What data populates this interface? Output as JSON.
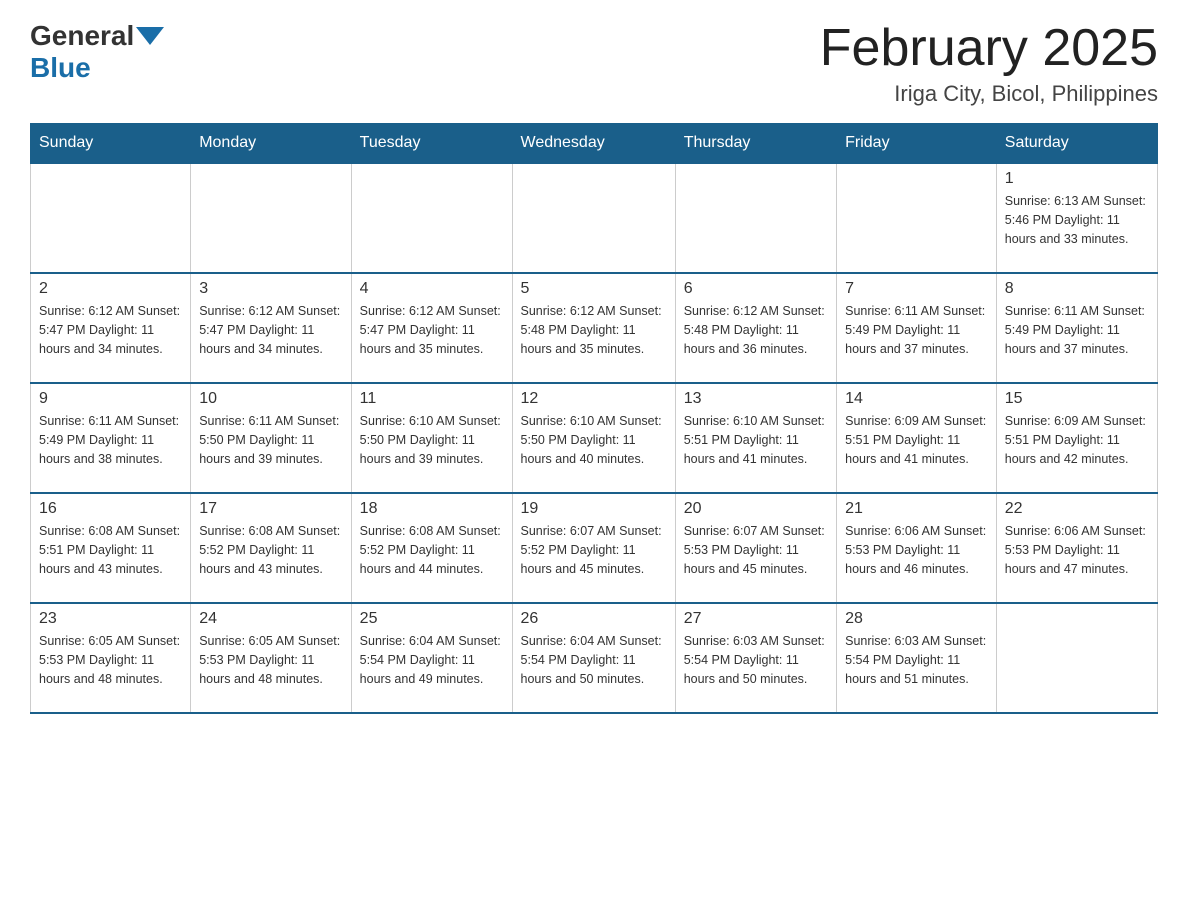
{
  "header": {
    "logo_general": "General",
    "logo_blue": "Blue",
    "month_title": "February 2025",
    "location": "Iriga City, Bicol, Philippines"
  },
  "days_of_week": [
    "Sunday",
    "Monday",
    "Tuesday",
    "Wednesday",
    "Thursday",
    "Friday",
    "Saturday"
  ],
  "weeks": [
    {
      "days": [
        {
          "number": "",
          "info": ""
        },
        {
          "number": "",
          "info": ""
        },
        {
          "number": "",
          "info": ""
        },
        {
          "number": "",
          "info": ""
        },
        {
          "number": "",
          "info": ""
        },
        {
          "number": "",
          "info": ""
        },
        {
          "number": "1",
          "info": "Sunrise: 6:13 AM\nSunset: 5:46 PM\nDaylight: 11 hours and 33 minutes."
        }
      ]
    },
    {
      "days": [
        {
          "number": "2",
          "info": "Sunrise: 6:12 AM\nSunset: 5:47 PM\nDaylight: 11 hours and 34 minutes."
        },
        {
          "number": "3",
          "info": "Sunrise: 6:12 AM\nSunset: 5:47 PM\nDaylight: 11 hours and 34 minutes."
        },
        {
          "number": "4",
          "info": "Sunrise: 6:12 AM\nSunset: 5:47 PM\nDaylight: 11 hours and 35 minutes."
        },
        {
          "number": "5",
          "info": "Sunrise: 6:12 AM\nSunset: 5:48 PM\nDaylight: 11 hours and 35 minutes."
        },
        {
          "number": "6",
          "info": "Sunrise: 6:12 AM\nSunset: 5:48 PM\nDaylight: 11 hours and 36 minutes."
        },
        {
          "number": "7",
          "info": "Sunrise: 6:11 AM\nSunset: 5:49 PM\nDaylight: 11 hours and 37 minutes."
        },
        {
          "number": "8",
          "info": "Sunrise: 6:11 AM\nSunset: 5:49 PM\nDaylight: 11 hours and 37 minutes."
        }
      ]
    },
    {
      "days": [
        {
          "number": "9",
          "info": "Sunrise: 6:11 AM\nSunset: 5:49 PM\nDaylight: 11 hours and 38 minutes."
        },
        {
          "number": "10",
          "info": "Sunrise: 6:11 AM\nSunset: 5:50 PM\nDaylight: 11 hours and 39 minutes."
        },
        {
          "number": "11",
          "info": "Sunrise: 6:10 AM\nSunset: 5:50 PM\nDaylight: 11 hours and 39 minutes."
        },
        {
          "number": "12",
          "info": "Sunrise: 6:10 AM\nSunset: 5:50 PM\nDaylight: 11 hours and 40 minutes."
        },
        {
          "number": "13",
          "info": "Sunrise: 6:10 AM\nSunset: 5:51 PM\nDaylight: 11 hours and 41 minutes."
        },
        {
          "number": "14",
          "info": "Sunrise: 6:09 AM\nSunset: 5:51 PM\nDaylight: 11 hours and 41 minutes."
        },
        {
          "number": "15",
          "info": "Sunrise: 6:09 AM\nSunset: 5:51 PM\nDaylight: 11 hours and 42 minutes."
        }
      ]
    },
    {
      "days": [
        {
          "number": "16",
          "info": "Sunrise: 6:08 AM\nSunset: 5:51 PM\nDaylight: 11 hours and 43 minutes."
        },
        {
          "number": "17",
          "info": "Sunrise: 6:08 AM\nSunset: 5:52 PM\nDaylight: 11 hours and 43 minutes."
        },
        {
          "number": "18",
          "info": "Sunrise: 6:08 AM\nSunset: 5:52 PM\nDaylight: 11 hours and 44 minutes."
        },
        {
          "number": "19",
          "info": "Sunrise: 6:07 AM\nSunset: 5:52 PM\nDaylight: 11 hours and 45 minutes."
        },
        {
          "number": "20",
          "info": "Sunrise: 6:07 AM\nSunset: 5:53 PM\nDaylight: 11 hours and 45 minutes."
        },
        {
          "number": "21",
          "info": "Sunrise: 6:06 AM\nSunset: 5:53 PM\nDaylight: 11 hours and 46 minutes."
        },
        {
          "number": "22",
          "info": "Sunrise: 6:06 AM\nSunset: 5:53 PM\nDaylight: 11 hours and 47 minutes."
        }
      ]
    },
    {
      "days": [
        {
          "number": "23",
          "info": "Sunrise: 6:05 AM\nSunset: 5:53 PM\nDaylight: 11 hours and 48 minutes."
        },
        {
          "number": "24",
          "info": "Sunrise: 6:05 AM\nSunset: 5:53 PM\nDaylight: 11 hours and 48 minutes."
        },
        {
          "number": "25",
          "info": "Sunrise: 6:04 AM\nSunset: 5:54 PM\nDaylight: 11 hours and 49 minutes."
        },
        {
          "number": "26",
          "info": "Sunrise: 6:04 AM\nSunset: 5:54 PM\nDaylight: 11 hours and 50 minutes."
        },
        {
          "number": "27",
          "info": "Sunrise: 6:03 AM\nSunset: 5:54 PM\nDaylight: 11 hours and 50 minutes."
        },
        {
          "number": "28",
          "info": "Sunrise: 6:03 AM\nSunset: 5:54 PM\nDaylight: 11 hours and 51 minutes."
        },
        {
          "number": "",
          "info": ""
        }
      ]
    }
  ]
}
